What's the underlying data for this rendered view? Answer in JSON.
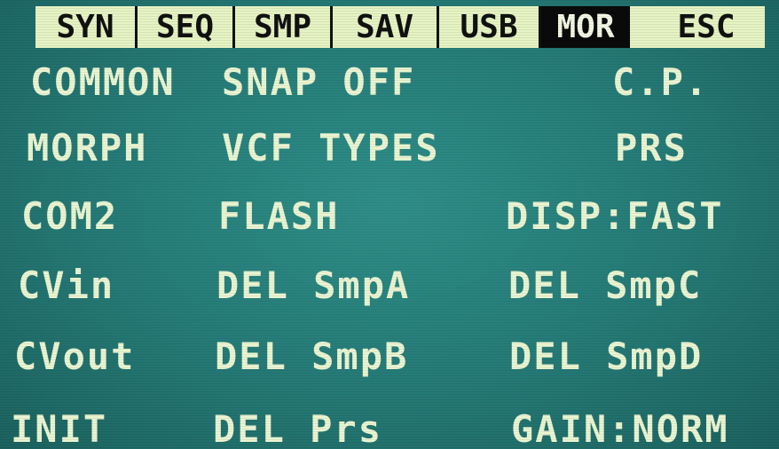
{
  "tabs": [
    {
      "label": "SYN",
      "active": false
    },
    {
      "label": "SEQ",
      "active": false
    },
    {
      "label": "SMP",
      "active": false
    },
    {
      "label": "SAV",
      "active": false
    },
    {
      "label": "USB",
      "active": false
    },
    {
      "label": "MOR",
      "active": true
    },
    {
      "label": "ESC",
      "active": false
    }
  ],
  "menu": {
    "common": "COMMON",
    "snap": "SNAP OFF",
    "cp": "C.P.",
    "morph": "MORPH",
    "vcf_types": "VCF TYPES",
    "prs": "PRS",
    "com2": "COM2",
    "flash": "FLASH",
    "disp": "DISP:FAST",
    "cvin": "CVin",
    "del_smpa": "DEL SmpA",
    "del_smpc": "DEL SmpC",
    "cvout": "CVout",
    "del_smpb": "DEL SmpB",
    "del_smpd": "DEL SmpD",
    "init": "INIT",
    "del_prs": "DEL Prs",
    "gain": "GAIN:NORM"
  },
  "colors": {
    "screen_bg": "#2a857f",
    "text": "#eaf5d2",
    "tab_bg": "#e6f3c3",
    "tab_text": "#111111",
    "tab_active_bg": "#0a0a0a"
  }
}
